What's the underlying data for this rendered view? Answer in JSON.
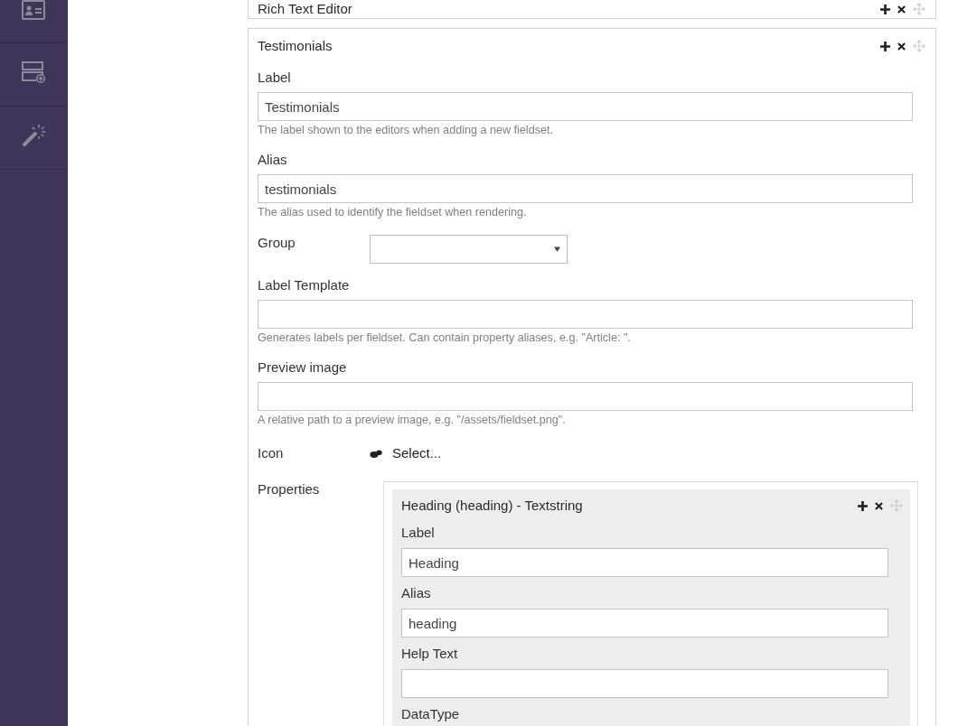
{
  "sidebar": {
    "items": [
      {
        "kind": "id-card"
      },
      {
        "kind": "layout-add"
      },
      {
        "kind": "wand"
      }
    ]
  },
  "fieldsets": [
    {
      "title": "Rich Text Editor"
    },
    {
      "title": "Testimonials",
      "fields": [
        {
          "kind": "text",
          "label": "Label",
          "value": "Testimonials",
          "help": "The label shown to the editors when adding a new fieldset."
        },
        {
          "kind": "text",
          "label": "Alias",
          "value": "testimonials",
          "help": "The alias used to identify the fieldset when rendering."
        },
        {
          "kind": "select",
          "label": "Group"
        },
        {
          "kind": "text",
          "label": "Label Template",
          "help": "Generates labels per fieldset. Can contain property aliases, e.g. \"Article: \"."
        },
        {
          "kind": "text",
          "label": "Preview image",
          "help": "A relative path to a preview image, e.g. \"/assets/fieldset.png\"."
        },
        {
          "kind": "icon-picker",
          "label": "Icon",
          "value": "Select..."
        },
        {
          "kind": "properties",
          "label": "Properties",
          "properties": [
            {
              "title": "Heading (heading) - Textstring",
              "fields": [
                {
                  "kind": "text",
                  "label": "Label",
                  "value": "Heading"
                },
                {
                  "kind": "text",
                  "label": "Alias",
                  "value": "heading"
                },
                {
                  "kind": "text",
                  "label": "Help Text"
                },
                {
                  "kind": "label-only",
                  "label": "DataType"
                }
              ]
            }
          ]
        }
      ]
    }
  ]
}
